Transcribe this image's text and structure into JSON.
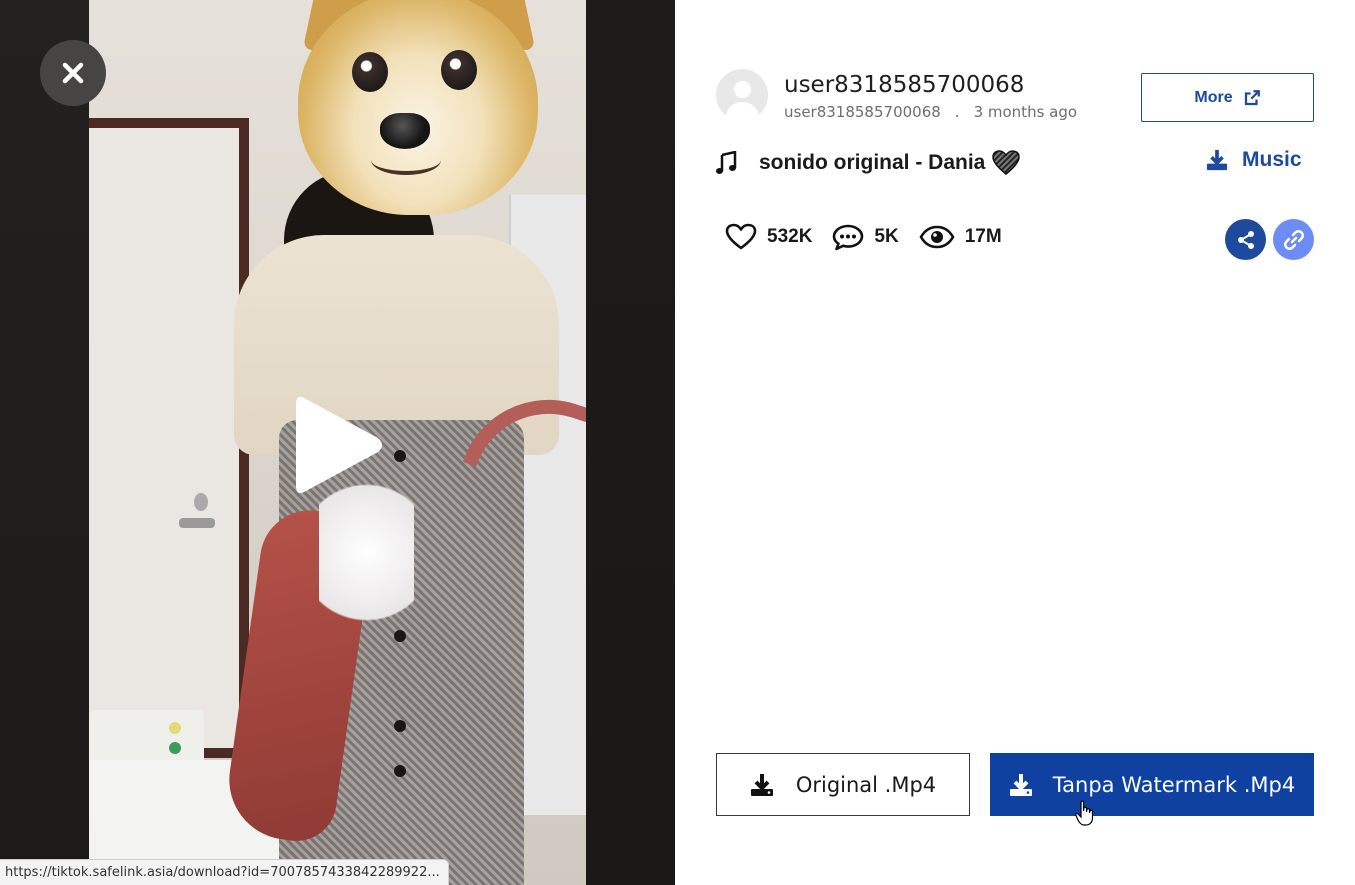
{
  "video": {
    "close_label": "close",
    "play_label": "play"
  },
  "status_bar": {
    "url": "https://tiktok.safelink.asia/download?id=7007857433842289922..."
  },
  "author": {
    "display_name": "user8318585700068",
    "handle": "user8318585700068",
    "separator": ".",
    "posted": "3 months ago"
  },
  "more_button": {
    "label": "More",
    "icon": "external-link-icon"
  },
  "music": {
    "icon": "music-note-icon",
    "title": "sonido original - Dania",
    "emoji": "black-heart-icon",
    "download_label": "Music",
    "download_icon": "download-icon"
  },
  "stats": {
    "likes": "532K",
    "comments": "5K",
    "views": "17M"
  },
  "actions": {
    "share_icon": "share-icon",
    "link_icon": "link-icon"
  },
  "downloads": {
    "original_label": "Original .Mp4",
    "no_watermark_label": "Tanpa Watermark .Mp4"
  },
  "colors": {
    "primary": "#1d4a9c",
    "primary_dark": "#0f42a0",
    "link_button": "#6e8cf5",
    "close_button": "#474543"
  }
}
